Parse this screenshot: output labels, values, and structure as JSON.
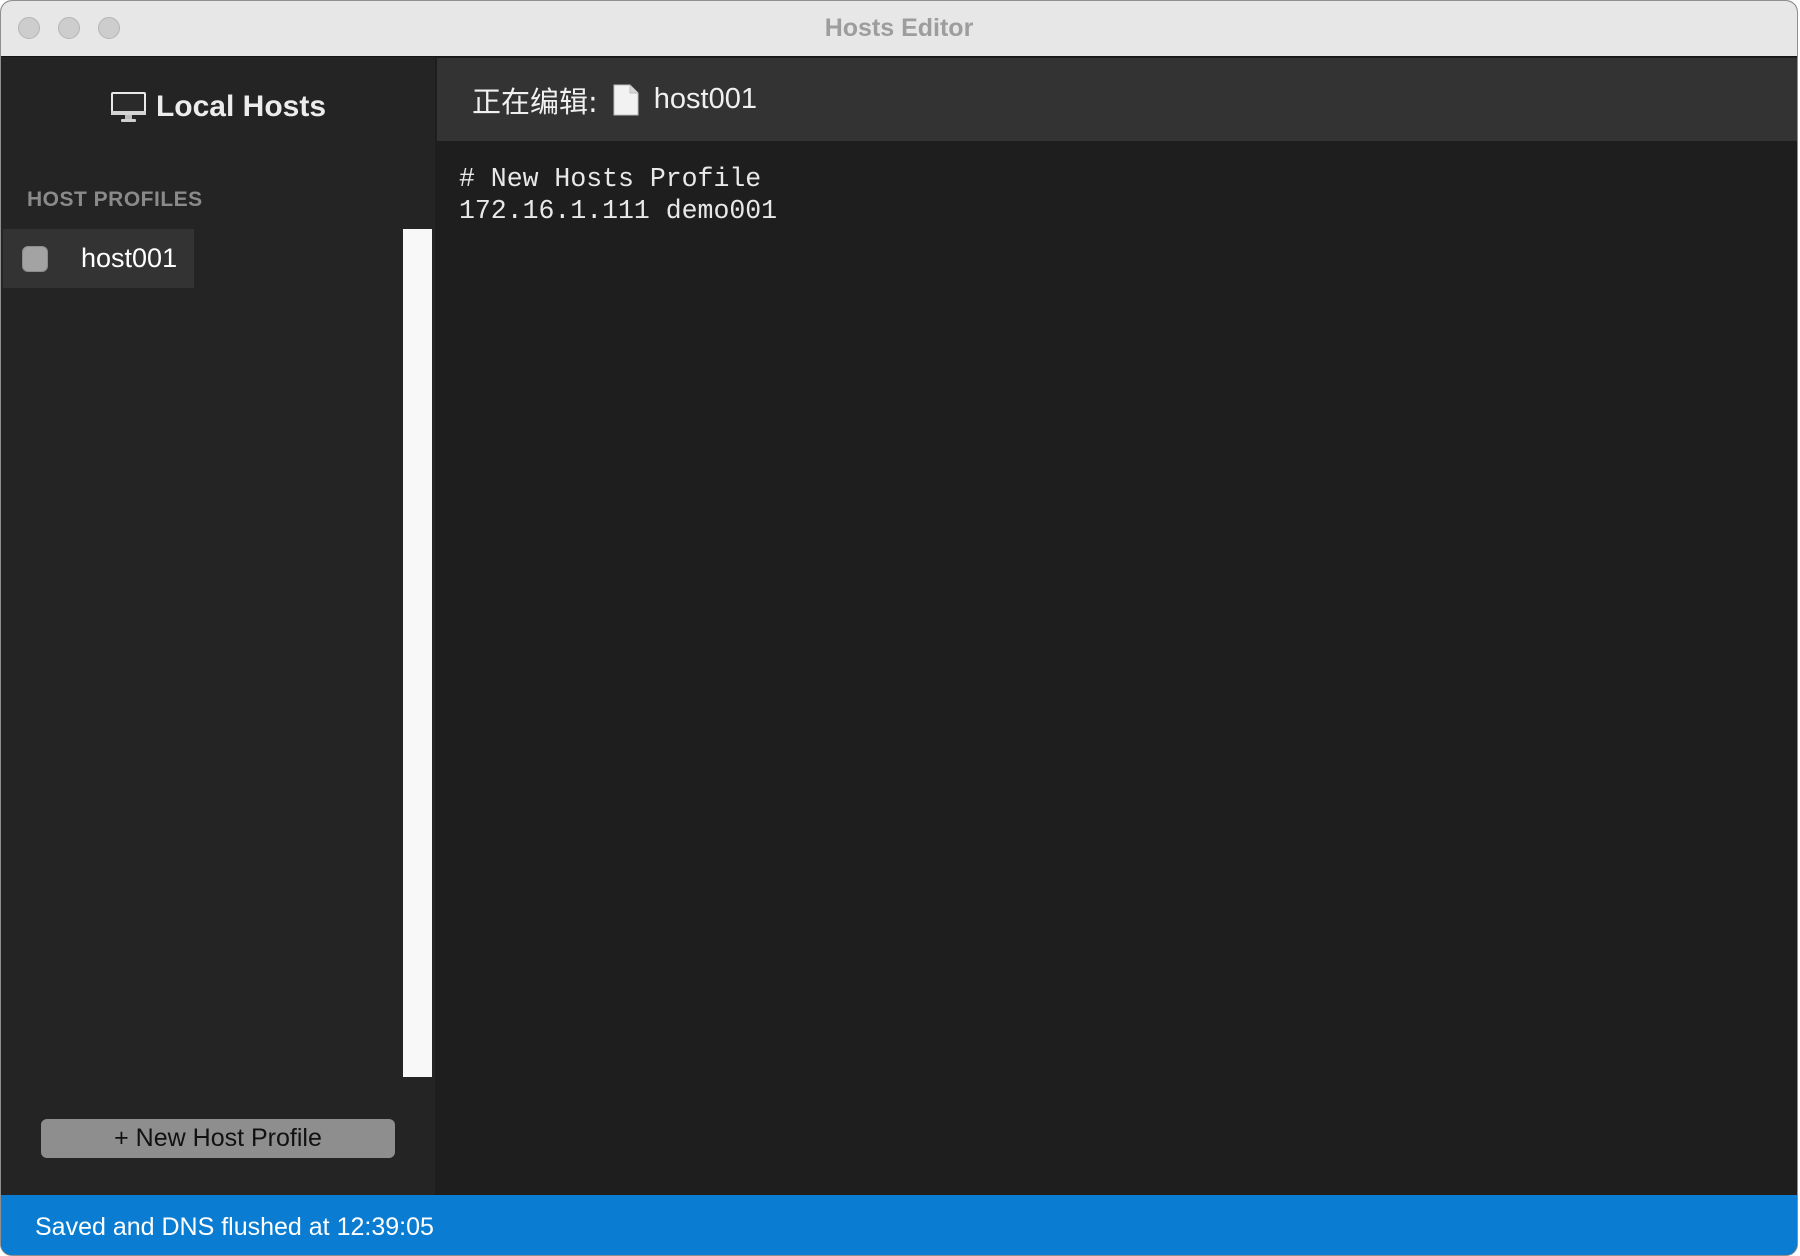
{
  "window": {
    "title": "Hosts Editor"
  },
  "sidebar": {
    "header_icon": "monitor-icon",
    "title": "Local Hosts",
    "section_label": "HOST PROFILES",
    "profiles": [
      {
        "name": "host001",
        "enabled": false,
        "selected": true
      }
    ],
    "new_button_label": "+ New Host Profile"
  },
  "editor": {
    "header_prefix": "正在编辑:",
    "file_icon": "document-icon",
    "file_name": "host001",
    "content": "# New Hosts Profile\n172.16.1.111 demo001"
  },
  "status_bar": {
    "text": "Saved and DNS flushed at 12:39:05"
  },
  "colors": {
    "status_bar": "#0a7dd3",
    "sidebar_bg": "#242424",
    "editor_bg": "#1e1e1e",
    "editor_header_bg": "#333333",
    "selected_row_bg": "#333333",
    "button_bg": "#8e8e8e"
  }
}
